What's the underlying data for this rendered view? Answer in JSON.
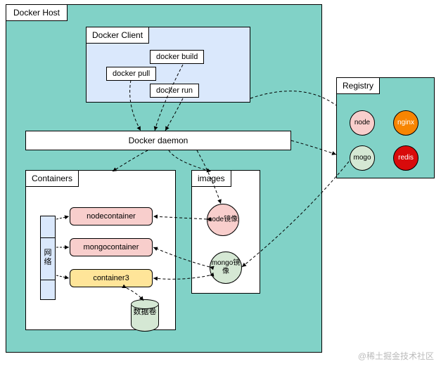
{
  "host_label": "Docker Host",
  "client": {
    "label": "Docker Client",
    "cmds": {
      "build": "docker build",
      "pull": "docker pull",
      "run": "docker run"
    }
  },
  "daemon": "Docker daemon",
  "containers": {
    "label": "Containers",
    "items": [
      "nodecontainer",
      "mongocontainer",
      "container3"
    ],
    "network_label": "网络",
    "datavol_label": "数据卷"
  },
  "images": {
    "label": "images",
    "items": [
      {
        "name": "node镜像",
        "color": "#f8cecc"
      },
      {
        "name": "mongo镜像",
        "color": "#d5e8d4"
      }
    ]
  },
  "registry": {
    "label": "Registry",
    "items": [
      {
        "name": "node",
        "bg": "#f8cecc",
        "fg": "#000"
      },
      {
        "name": "nginx",
        "bg": "#f78502",
        "fg": "#fff"
      },
      {
        "name": "mogo",
        "bg": "#d5e8d4",
        "fg": "#000"
      },
      {
        "name": "redis",
        "bg": "#d80b0b",
        "fg": "#fff"
      }
    ]
  },
  "watermark": "@稀土掘金技术社区"
}
